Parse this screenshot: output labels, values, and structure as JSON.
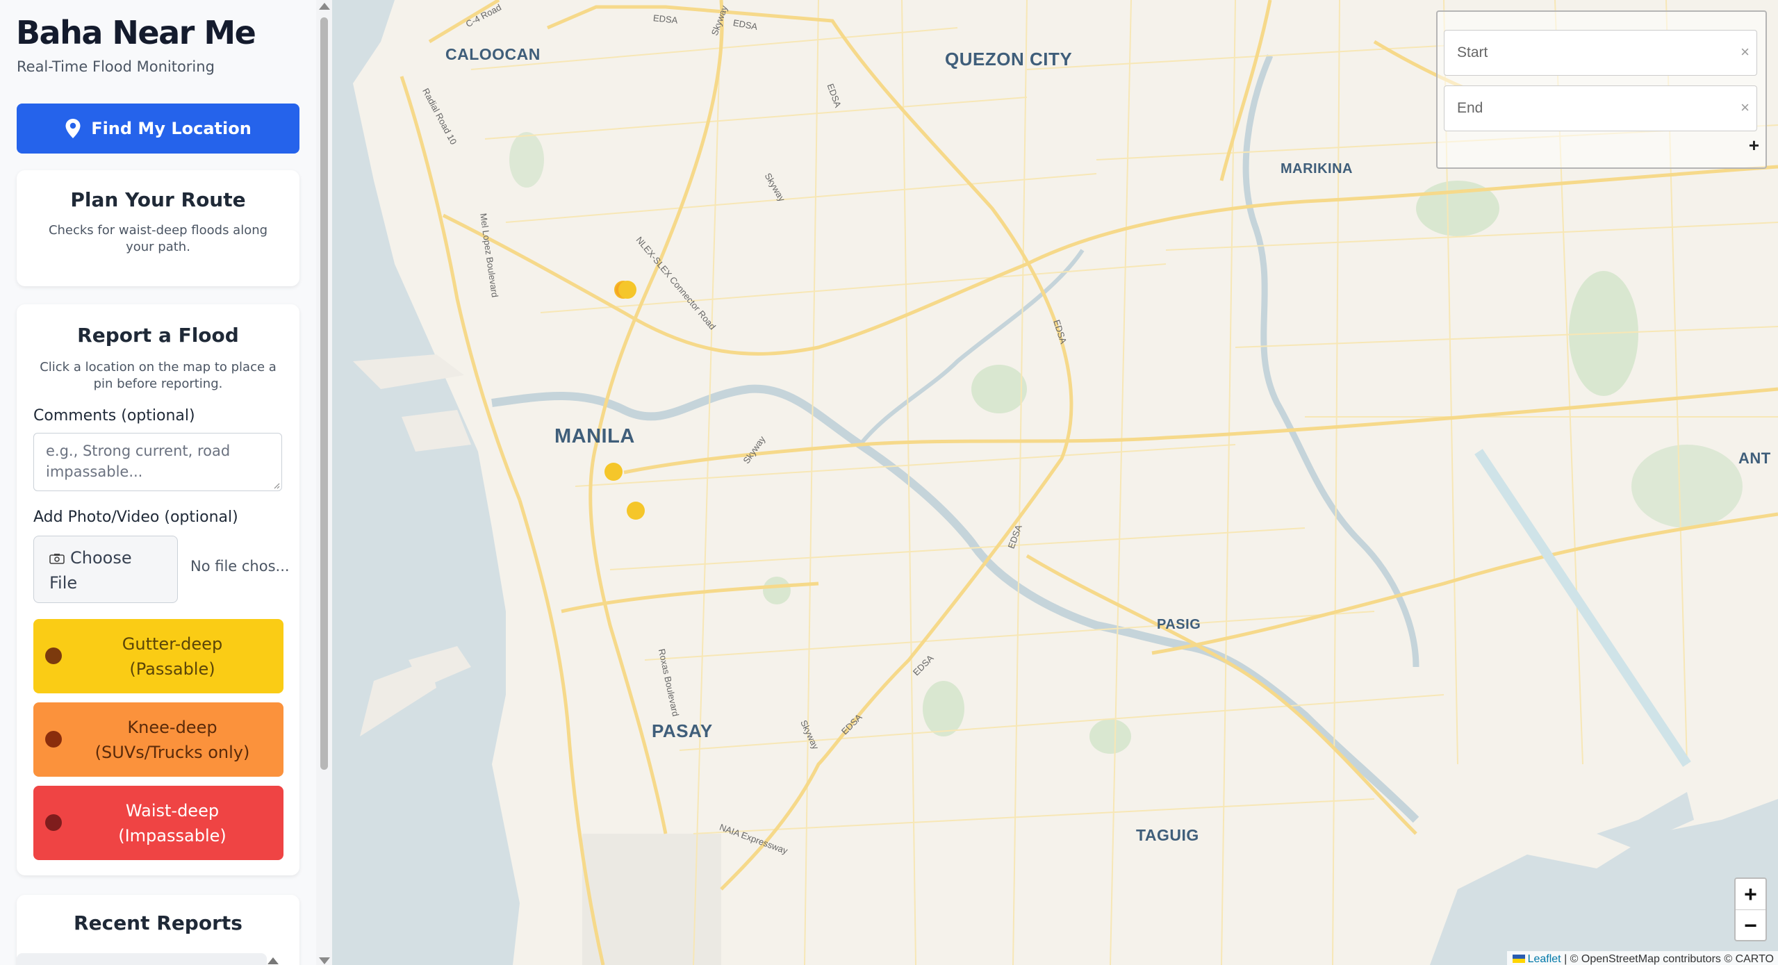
{
  "sidebar": {
    "title": "Baha Near Me",
    "subtitle": "Real-Time Flood Monitoring",
    "find_location_label": "Find My Location",
    "route_card": {
      "title": "Plan Your Route",
      "description": "Checks for waist-deep floods along your path."
    },
    "report_card": {
      "title": "Report a Flood",
      "description": "Click a location on the map to place a pin before reporting.",
      "comments_label": "Comments (optional)",
      "comments_placeholder": "e.g., Strong current, road impassable...",
      "photo_label": "Add Photo/Video (optional)",
      "choose_file_label": "Choose File",
      "file_status": "No file chos...",
      "severity_buttons": [
        {
          "label": "Gutter-deep (Passable)",
          "color": "#facc15",
          "dot": "#7c3a0e"
        },
        {
          "label": "Knee-deep (SUVs/Trucks only)",
          "color": "#fb923c",
          "dot": "#8a2d0c"
        },
        {
          "label": "Waist-deep (Impassable)",
          "color": "#ef4444",
          "dot": "#7f1d1d"
        }
      ]
    },
    "recent_card": {
      "title": "Recent Reports"
    }
  },
  "map": {
    "cities": [
      "CALOOCAN",
      "QUEZON CITY",
      "MARIKINA",
      "MANILA",
      "PASIG",
      "PASAY",
      "TAGUIG",
      "ANT"
    ],
    "roads": [
      "C-4 Road",
      "EDSA",
      "Skyway",
      "Radial Road 10",
      "Mel Lopez Boulevard",
      "NLEX-SLEX Connector Road",
      "Roxas Boulevard",
      "NAIA Expressway"
    ],
    "marker_color": "#f5c62a",
    "routing": {
      "start_placeholder": "Start",
      "end_placeholder": "End",
      "clear_symbol": "×",
      "add_waypoint_symbol": "+"
    },
    "zoom": {
      "in": "+",
      "out": "−"
    },
    "attribution": {
      "leaflet": "Leaflet",
      "rest": " | © OpenStreetMap contributors © CARTO"
    }
  }
}
